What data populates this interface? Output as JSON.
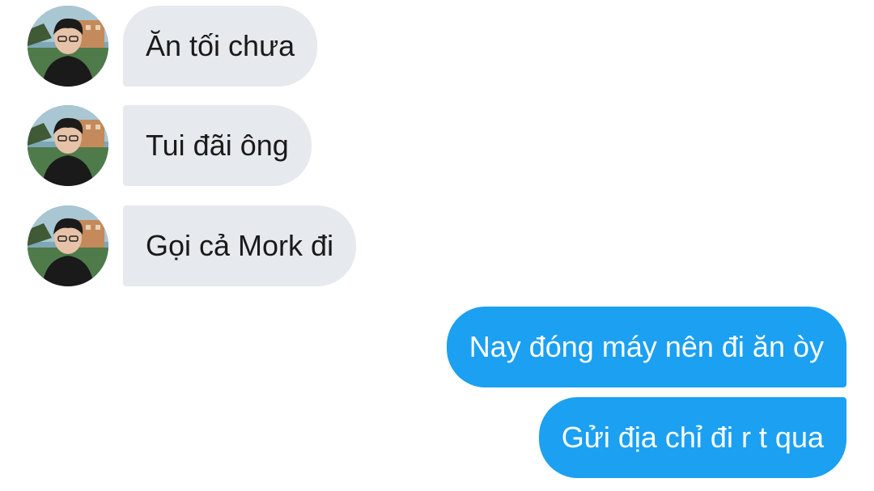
{
  "conversation": {
    "incoming": [
      {
        "text": "Ăn tối chưa"
      },
      {
        "text": "Tui đãi ông"
      },
      {
        "text": "Gọi cả Mork đi"
      }
    ],
    "outgoing": [
      {
        "text": "Nay đóng máy nên đi ăn òy"
      },
      {
        "text": "Gửi địa chỉ đi r t qua"
      }
    ]
  },
  "colors": {
    "incoming_bubble": "#e6eaee",
    "outgoing_bubble": "#1ba0f2",
    "incoming_text": "#1a1a1a",
    "outgoing_text": "#ffffff"
  }
}
